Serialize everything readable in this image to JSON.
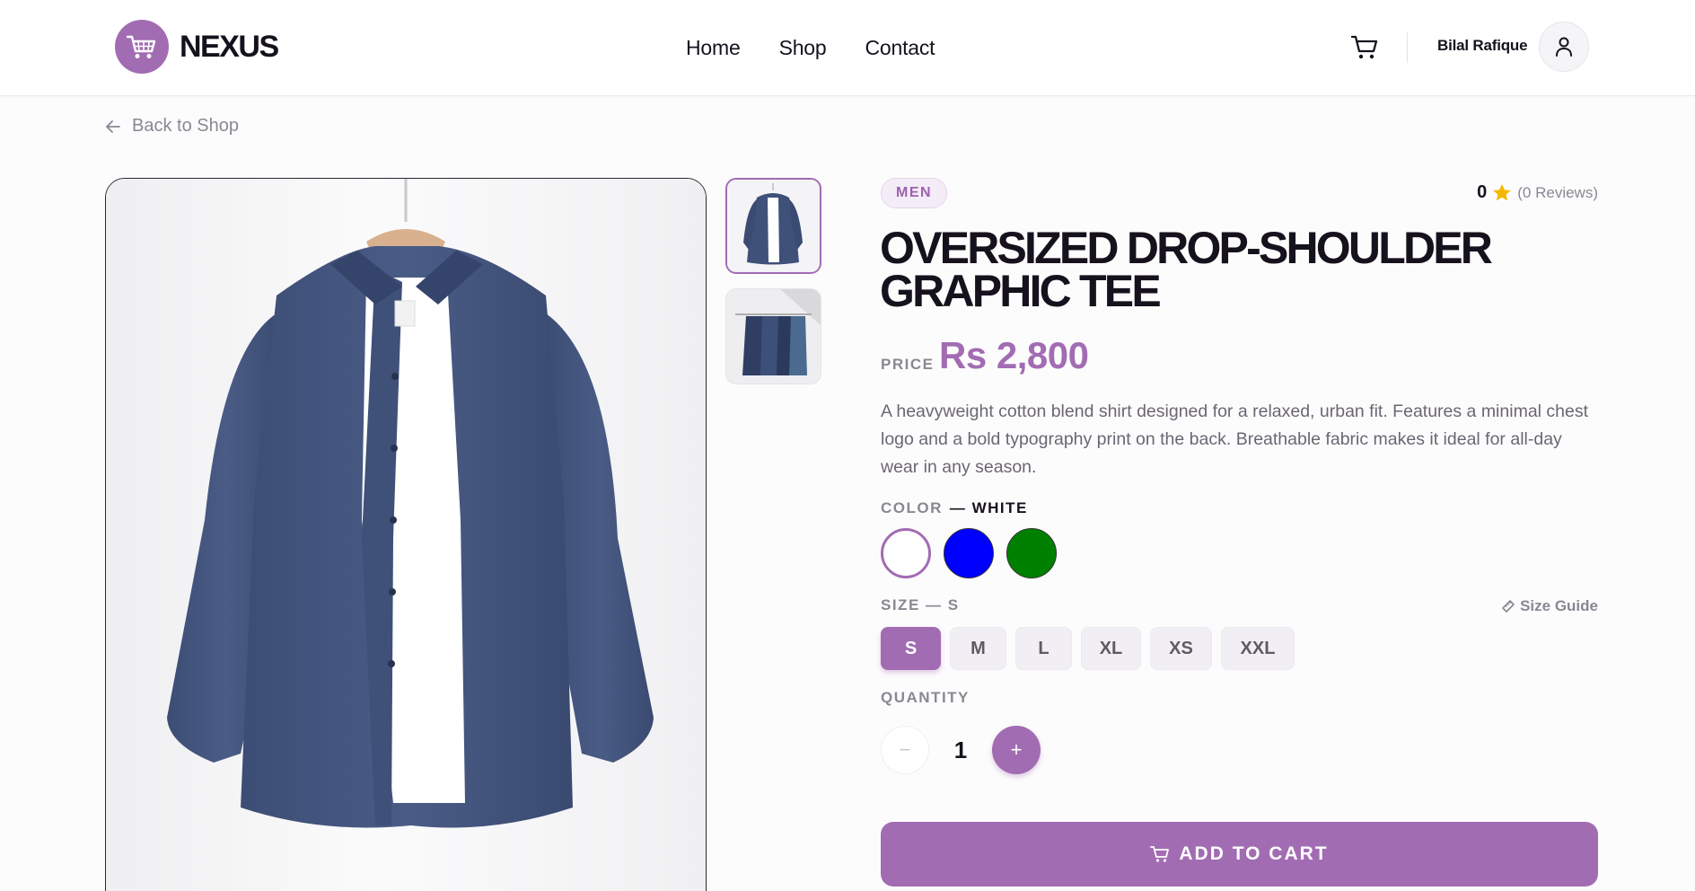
{
  "brand": {
    "name": "NEXUS"
  },
  "nav": [
    {
      "label": "Home"
    },
    {
      "label": "Shop"
    },
    {
      "label": "Contact"
    }
  ],
  "user": {
    "name": "Bilal Rafique"
  },
  "back_link": "Back to Shop",
  "product": {
    "category_tag": "MEN",
    "rating": "0",
    "reviews": "(0 Reviews)",
    "title": "OVERSIZED DROP-SHOULDER GRAPHIC TEE",
    "price_label": "PRICE",
    "price": "Rs 2,800",
    "description": "A heavyweight cotton blend shirt designed for a relaxed, urban fit. Features a minimal chest logo and a bold typography print on the back. Breathable fabric makes it ideal for all-day wear in any season."
  },
  "color": {
    "label": "COLOR",
    "selected_text": "— WHITE",
    "options": [
      {
        "name": "white",
        "hex": "#ffffff",
        "selected": true
      },
      {
        "name": "blue",
        "hex": "#0000ff",
        "selected": false
      },
      {
        "name": "green",
        "hex": "#008000",
        "selected": false
      }
    ]
  },
  "size": {
    "label": "SIZE — S",
    "guide": "Size Guide",
    "options": [
      "S",
      "M",
      "L",
      "XL",
      "XS",
      "XXL"
    ],
    "selected": "S"
  },
  "quantity": {
    "label": "QUANTITY",
    "value": "1",
    "minus": "−",
    "plus": "+"
  },
  "add_to_cart": "ADD TO CART",
  "colors": {
    "accent": "#a26cb3",
    "text": "#16121d",
    "muted": "#8b8792",
    "star": "#f5b800"
  }
}
